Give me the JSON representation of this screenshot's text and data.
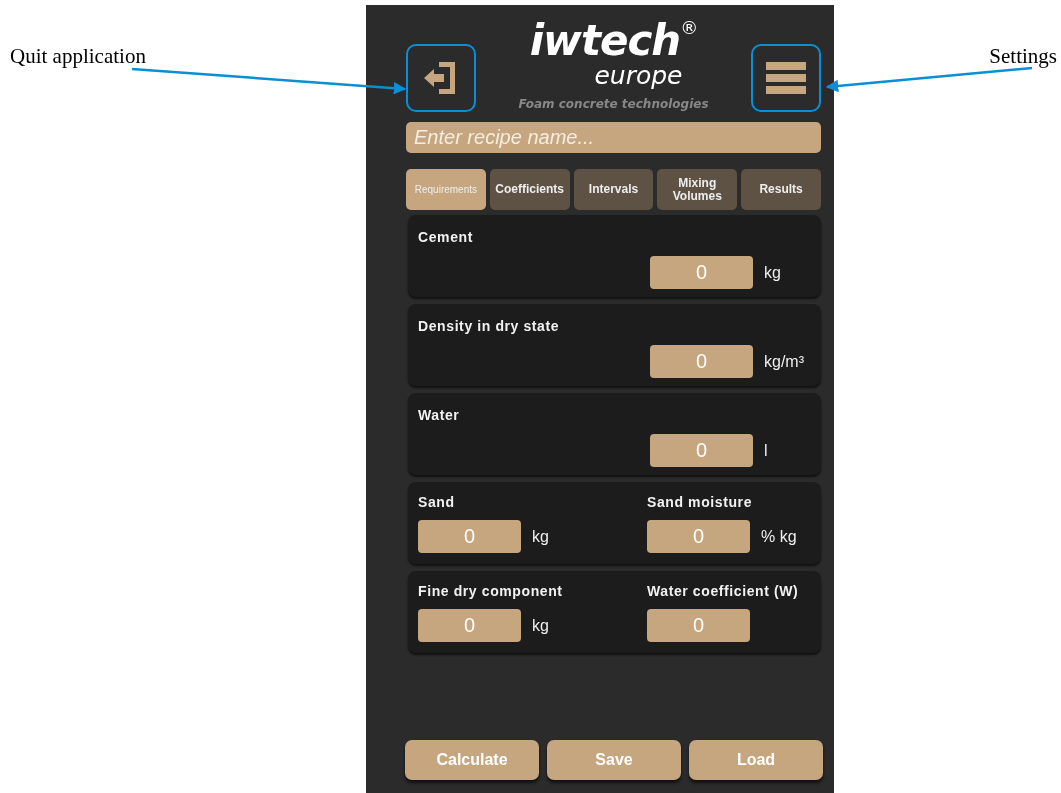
{
  "annotations": [
    {
      "text": "Quit application",
      "kind": "left"
    },
    {
      "text": "Settings",
      "kind": "right"
    }
  ],
  "header": {
    "logo": "iwtech",
    "registered": "®",
    "logo_sub": "europe",
    "tagline": "Foam concrete technologies"
  },
  "recipe_field": {
    "placeholder": "Enter recipe name..."
  },
  "tabs": [
    {
      "label": "Requirements",
      "selected": true
    },
    {
      "label": "Coefficients",
      "selected": false
    },
    {
      "label": "Intervals",
      "selected": false
    },
    {
      "label": "Mixing Volumes",
      "selected": false
    },
    {
      "label": "Results",
      "selected": false
    }
  ],
  "cards": [
    {
      "kind": "single",
      "fields": [
        {
          "label": "Cement",
          "value": "0",
          "unit": "kg"
        }
      ]
    },
    {
      "kind": "single",
      "fields": [
        {
          "label": "Density in dry state",
          "value": "0",
          "unit": "kg/m³"
        }
      ]
    },
    {
      "kind": "single",
      "fields": [
        {
          "label": "Water",
          "value": "0",
          "unit": "l"
        }
      ]
    },
    {
      "kind": "pair",
      "fields": [
        {
          "label": "Sand",
          "value": "0",
          "unit": "kg"
        },
        {
          "label": "Sand moisture",
          "value": "0",
          "unit": "% kg"
        }
      ]
    },
    {
      "kind": "pair",
      "fields": [
        {
          "label": "Fine dry component",
          "value": "0",
          "unit": "kg"
        },
        {
          "label": "Water coefficient (W)",
          "value": "0"
        }
      ]
    }
  ],
  "buttons": [
    "Calculate",
    "Save",
    "Load"
  ]
}
